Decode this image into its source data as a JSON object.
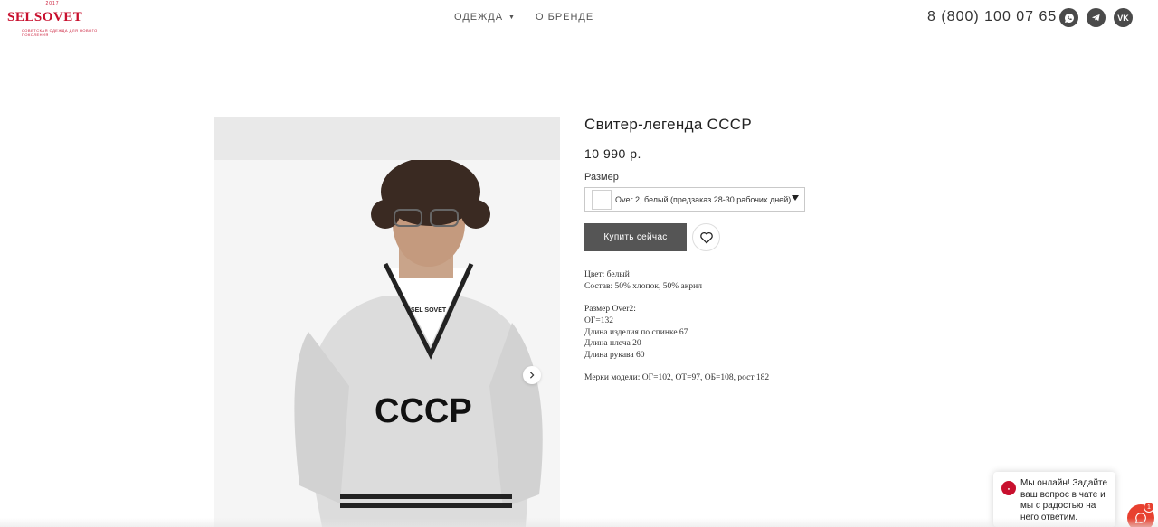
{
  "header": {
    "logo_year": "2017",
    "logo_text": "SELSOVET",
    "logo_sub": "СОВЕТСКАЯ ОДЕЖДА ДЛЯ НОВОГО ПОКОЛЕНИЯ",
    "nav": [
      {
        "label": "ОДЕЖДА",
        "has_dropdown": true
      },
      {
        "label": "О БРЕНДЕ",
        "has_dropdown": false
      }
    ],
    "phone": "8 (800) 100 07 65",
    "socials": [
      {
        "name": "whatsapp-icon",
        "glyph": "✆"
      },
      {
        "name": "telegram-icon",
        "glyph": "➤"
      },
      {
        "name": "vk-icon",
        "glyph": "VK"
      }
    ]
  },
  "product": {
    "title": "Свитер-легенда СССР",
    "price": "10 990 р.",
    "size_label": "Размер",
    "size_selected": "Over 2, белый (предзаказ 28-30 рабочих дней)",
    "buy_label": "Купить сейчас",
    "description": [
      "Цвет: белый",
      "Состав: 50% хлопок, 50% акрил",
      "",
      "Размер Over2:",
      "ОГ=132",
      "Длина изделия по спинке 67",
      "Длина плеча 20",
      "Длина рукава 60",
      "",
      "Мерки модели: ОГ=102, ОТ=97, ОБ=108, рост 182"
    ]
  },
  "photo": {
    "print_text": "СССР",
    "label_text": "SEL SOVET"
  },
  "chat": {
    "message": "Мы онлайн! Задайте ваш вопрос в чате и мы с радостью на него ответим.",
    "badge": "1"
  },
  "colors": {
    "brand": "#c8102e",
    "button": "#555555",
    "chat_accent": "#e8402f"
  }
}
